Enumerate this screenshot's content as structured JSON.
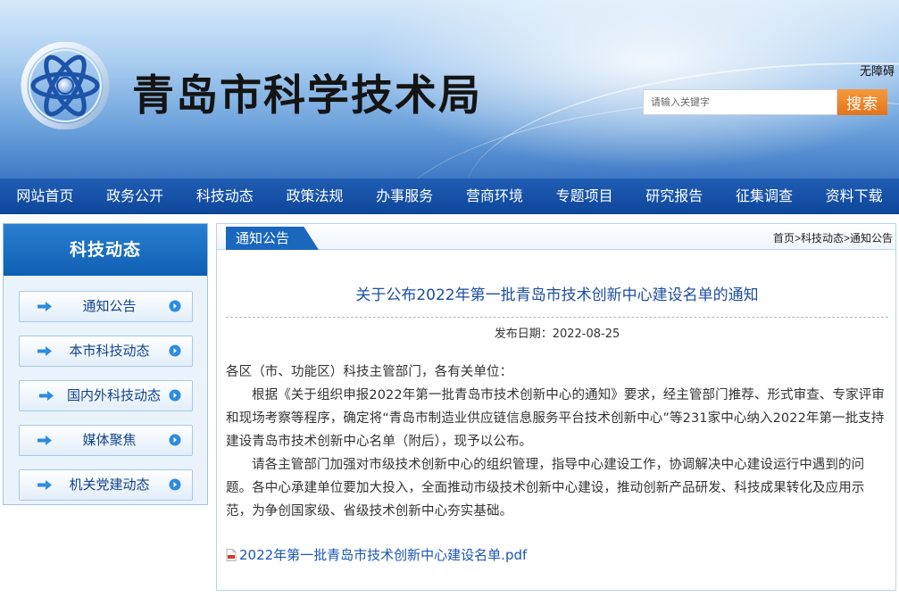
{
  "header": {
    "site_title": "青岛市科学技术局",
    "accessibility_label": "无障碍",
    "search_placeholder": "请输入关键字",
    "search_button_label": "搜索"
  },
  "nav": {
    "items": [
      {
        "label": "网站首页"
      },
      {
        "label": "政务公开"
      },
      {
        "label": "科技动态"
      },
      {
        "label": "政策法规"
      },
      {
        "label": "办事服务"
      },
      {
        "label": "营商环境"
      },
      {
        "label": "专题项目"
      },
      {
        "label": "研究报告"
      },
      {
        "label": "征集调查"
      },
      {
        "label": "资料下载"
      }
    ]
  },
  "sidebar": {
    "title": "科技动态",
    "items": [
      {
        "label": "通知公告"
      },
      {
        "label": "本市科技动态"
      },
      {
        "label": "国内外科技动态"
      },
      {
        "label": "媒体聚焦"
      },
      {
        "label": "机关党建动态"
      }
    ]
  },
  "main": {
    "tab_label": "通知公告",
    "breadcrumb": [
      "首页",
      ">",
      "科技动态",
      ">",
      "通知公告"
    ],
    "article_title": "关于公布2022年第一批青岛市技术创新中心建设名单的通知",
    "publish_date": "发布日期：2022-08-25",
    "paragraphs": [
      "各区（市、功能区）科技主管部门，各有关单位：",
      "根据《关于组织申报2022年第一批青岛市技术创新中心的通知》要求，经主管部门推荐、形式审查、专家评审和现场考察等程序，确定将“青岛市制造业供应链信息服务平台技术创新中心”等231家中心纳入2022年第一批支持建设青岛市技术创新中心名单（附后），现予以公布。",
      "请各主管部门加强对市级技术创新中心的组织管理，指导中心建设工作，协调解决中心建设运行中遇到的问题。各中心承建单位要加大投入，全面推动市级技术创新中心建设，推动创新产品研发、科技成果转化及应用示范，为争创国家级、省级技术创新中心夯实基础。"
    ],
    "attachment_label": "2022年第一批青岛市技术创新中心建设名单.pdf"
  },
  "colors": {
    "nav_bg": "#0e479c",
    "accent_orange": "#e4741b",
    "title_blue": "#1e4ea2",
    "link_blue": "#1b56b3"
  }
}
